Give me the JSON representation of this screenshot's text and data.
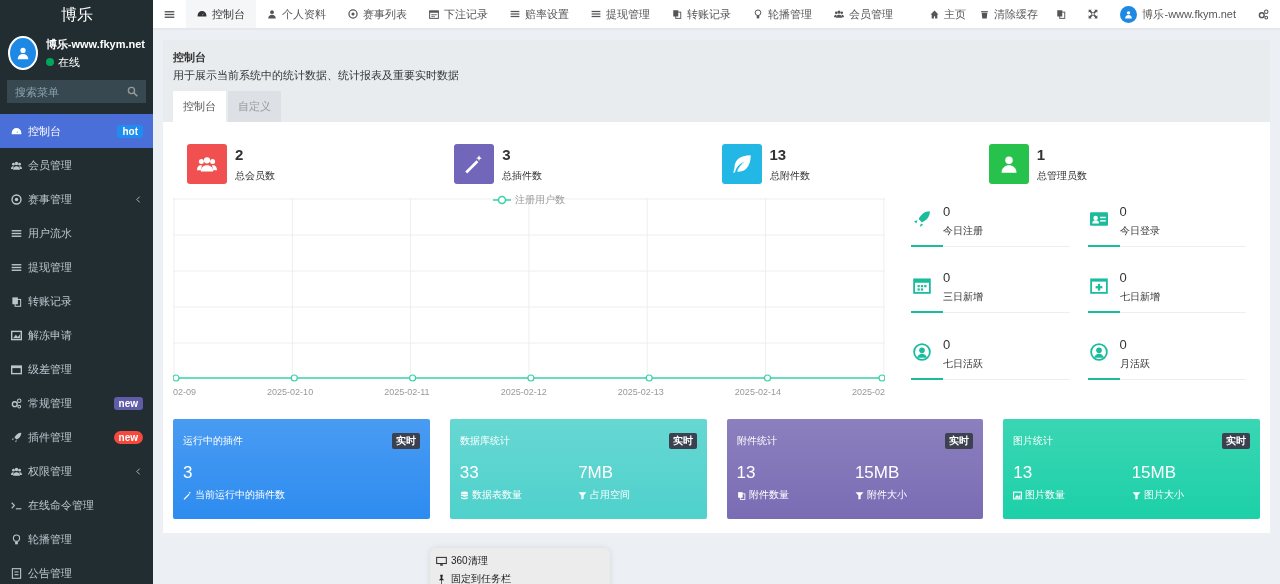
{
  "sidebar": {
    "logo": "博乐",
    "user": {
      "name": "博乐-www.fkym.net",
      "status": "在线",
      "online": true
    },
    "search": {
      "placeholder": "搜索菜单"
    },
    "items": [
      {
        "label": "控制台",
        "selected": true,
        "collapsible": false,
        "badge": {
          "text": "hot",
          "color": "#1e8cf0"
        }
      },
      {
        "label": "会员管理",
        "selected": false,
        "collapsible": false
      },
      {
        "label": "赛事管理",
        "selected": false,
        "collapsible": true
      },
      {
        "label": "用户流水",
        "selected": false,
        "collapsible": false
      },
      {
        "label": "提现管理",
        "selected": false,
        "collapsible": false
      },
      {
        "label": "转账记录",
        "selected": false,
        "collapsible": false
      },
      {
        "label": "解冻申请",
        "selected": false,
        "collapsible": false
      },
      {
        "label": "级差管理",
        "selected": false,
        "collapsible": false
      },
      {
        "label": "常规管理",
        "selected": false,
        "collapsible": false,
        "badge": {
          "text": "new",
          "color": "#605ca8"
        }
      },
      {
        "label": "插件管理",
        "selected": false,
        "collapsible": false,
        "badge": {
          "text": "new",
          "color": "#f5493d"
        }
      },
      {
        "label": "权限管理",
        "selected": false,
        "collapsible": true
      },
      {
        "label": "在线命令管理",
        "selected": false,
        "collapsible": false
      },
      {
        "label": "轮播管理",
        "selected": false,
        "collapsible": false
      },
      {
        "label": "公告管理",
        "selected": false,
        "collapsible": false
      }
    ]
  },
  "topbar": {
    "tabs": [
      {
        "label": "控制台",
        "selected": true
      },
      {
        "label": "个人资料",
        "selected": false
      },
      {
        "label": "赛事列表",
        "selected": false
      },
      {
        "label": "下注记录",
        "selected": false
      },
      {
        "label": "赔率设置",
        "selected": false
      },
      {
        "label": "提现管理",
        "selected": false
      },
      {
        "label": "转账记录",
        "selected": false
      },
      {
        "label": "轮播管理",
        "selected": false
      },
      {
        "label": "会员管理",
        "selected": false
      }
    ],
    "links": [
      "主页",
      "清除缓存"
    ],
    "user": "博乐-www.fkym.net"
  },
  "page": {
    "title": "控制台",
    "description": "用于展示当前系统中的统计数据、统计报表及重要实时数据",
    "tabs": [
      {
        "label": "控制台",
        "selected": true
      },
      {
        "label": "自定义",
        "selected": false
      }
    ]
  },
  "stats": [
    {
      "value": "2",
      "label": "总会员数",
      "color": "#f05050"
    },
    {
      "value": "3",
      "label": "总插件数",
      "color": "#7266ba"
    },
    {
      "value": "13",
      "label": "总附件数",
      "color": "#23b7e5"
    },
    {
      "value": "1",
      "label": "总管理员数",
      "color": "#27c24c"
    }
  ],
  "chart": {
    "legend": "注册用户数",
    "x_labels": [
      "02-09",
      "2025-02-10",
      "2025-02-11",
      "2025-02-12",
      "2025-02-13",
      "2025-02-14",
      "2025-02"
    ]
  },
  "mini_stats": [
    {
      "value": "0",
      "label": "今日注册"
    },
    {
      "value": "0",
      "label": "今日登录"
    },
    {
      "value": "0",
      "label": "三日新增"
    },
    {
      "value": "0",
      "label": "七日新增"
    },
    {
      "value": "0",
      "label": "七日活跃"
    },
    {
      "value": "0",
      "label": "月活跃"
    }
  ],
  "cards": [
    {
      "title": "运行中的插件",
      "badge": "实时",
      "color": "#2d8cf0",
      "metrics": [
        {
          "value": "3",
          "label": "当前运行中的插件数"
        }
      ]
    },
    {
      "title": "数据库统计",
      "badge": "实时",
      "color": "#4fd1cc",
      "metrics": [
        {
          "value": "33",
          "label": "数据表数量"
        },
        {
          "value": "7MB",
          "label": "占用空间"
        }
      ]
    },
    {
      "title": "附件统计",
      "badge": "实时",
      "color": "#7a6cb4",
      "metrics": [
        {
          "value": "13",
          "label": "附件数量"
        },
        {
          "value": "15MB",
          "label": "附件大小"
        }
      ]
    },
    {
      "title": "图片统计",
      "badge": "实时",
      "color": "#1cd0a8",
      "metrics": [
        {
          "value": "13",
          "label": "图片数量"
        },
        {
          "value": "15MB",
          "label": "图片大小"
        }
      ]
    }
  ],
  "context_menu": {
    "items": [
      "360清理",
      "固定到任务栏"
    ]
  }
}
